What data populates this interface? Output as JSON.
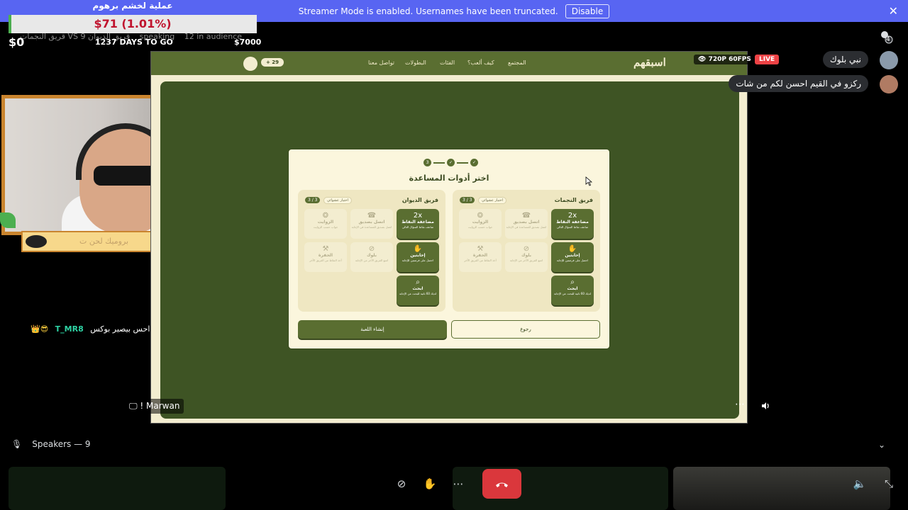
{
  "banner": {
    "text": "Streamer Mode is enabled. Usernames have been truncated.",
    "disable_label": "Disable"
  },
  "goal": {
    "title": "عملية لخشم برهوم",
    "value": "$71 (1.01%)",
    "progress_fraction": 0.0101,
    "min": "$0",
    "days": "1237 DAYS TO GO",
    "max": "$7000"
  },
  "channel": {
    "title": "قريق النجمات VS فريق الديوان",
    "speaking": "9 speaking",
    "audience": "12 in audience"
  },
  "cam": {
    "name_tag": "بروميك لحن ت"
  },
  "chat_overlay": {
    "badges": "👑😎",
    "user": "T_MR8",
    "message": "احس بيصير بوكس"
  },
  "stream": {
    "quality": "720P 60FPS",
    "live": "LIVE",
    "name": "! Marwan",
    "more": "⋯"
  },
  "site": {
    "logo": "اسبقهم",
    "nav": [
      "المجتمع",
      "كيف ألعب؟",
      "الفئات",
      "البطولات",
      "تواصل معنا"
    ],
    "coins": "+ 29"
  },
  "modal": {
    "steps": [
      "✓",
      "✓",
      "3"
    ],
    "title": "اختر أدوات المساعدة",
    "teams": [
      {
        "name": "فريق النجمات",
        "count": "3 / 3",
        "random": "اختيار عشوائي",
        "tools": [
          {
            "icon": "2x",
            "name": "مضاعفة النقاط",
            "desc": "ضاعف نقاط السؤال التالي",
            "on": true
          },
          {
            "icon": "☎",
            "name": "اتصل بصديق",
            "desc": "اتصل بصديق للمساعدة في الإجابة",
            "on": false
          },
          {
            "icon": "❂",
            "name": "الزوايت",
            "desc": "جواب حسب الزوايت",
            "on": false
          },
          {
            "icon": "✋",
            "name": "إحابتين",
            "desc": "احصل على فرصتين للإجابة",
            "on": true
          },
          {
            "icon": "⊘",
            "name": "بلوك",
            "desc": "امنع الفريق الآخر من الإجابة",
            "on": false
          },
          {
            "icon": "⚒",
            "name": "الحفرة",
            "desc": "أخذ النقاط من الفريق الآخر",
            "on": false
          },
          {
            "icon": "⌕",
            "name": "ابحث",
            "desc": "لديك 60 ثانية للبحث عن الإجابة",
            "on": true
          }
        ]
      },
      {
        "name": "فريق الديوان",
        "count": "3 / 3",
        "random": "اختيار عشوائي",
        "tools": [
          {
            "icon": "2x",
            "name": "مضاعفة النقاط",
            "desc": "ضاعف نقاط السؤال التالي",
            "on": true
          },
          {
            "icon": "☎",
            "name": "اتصل بصديق",
            "desc": "اتصل بصديق للمساعدة في الإجابة",
            "on": false
          },
          {
            "icon": "❂",
            "name": "الزوايت",
            "desc": "جواب حسب الزوايت",
            "on": false
          },
          {
            "icon": "✋",
            "name": "إحابتين",
            "desc": "احصل على فرصتين للإجابة",
            "on": true
          },
          {
            "icon": "⊘",
            "name": "بلوك",
            "desc": "امنع الفريق الآخر من الإجابة",
            "on": false
          },
          {
            "icon": "⚒",
            "name": "الحفرة",
            "desc": "أخذ النقاط من الفريق الآخر",
            "on": false
          },
          {
            "icon": "⌕",
            "name": "ابحث",
            "desc": "لديك 60 ثانية للبحث عن الإجابة",
            "on": true
          }
        ]
      }
    ],
    "create_label": "إنشاء اللعبة",
    "back_label": "رجوع"
  },
  "right_chat": {
    "viewer_count": "4",
    "messages": [
      {
        "text": "نبي بلوك"
      },
      {
        "text": "ركزو في القيم احسن لكم من شات"
      }
    ]
  },
  "speakers": {
    "label": "Speakers — 9"
  }
}
